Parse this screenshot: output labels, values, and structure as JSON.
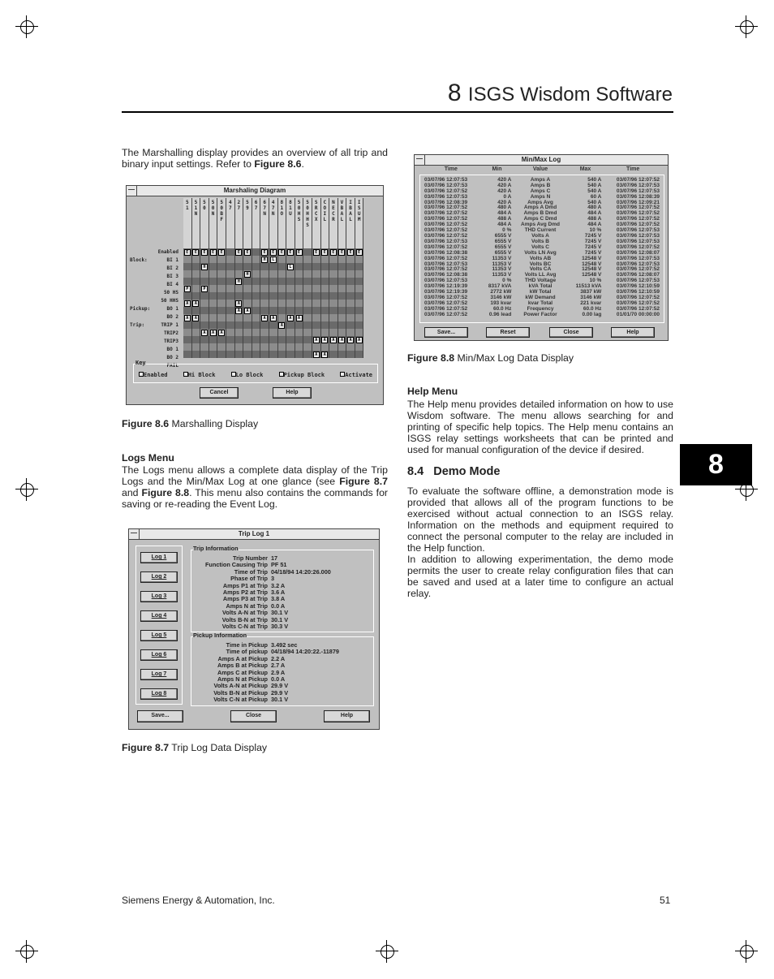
{
  "header": {
    "chapter_number": "8",
    "chapter_title": "ISGS Wisdom Software"
  },
  "tab": {
    "label": "8"
  },
  "left": {
    "intro": "The Marshalling display provides an overview of all trip and binary input settings. Refer to ",
    "intro_ref": "Figure 8.6",
    "logs_heading": "Logs Menu",
    "logs_text_1": "The Logs menu allows a complete data display of the Trip Logs and the Min/Max Log at one glance (see ",
    "logs_ref1": "Figure 8.7",
    "logs_and": " and ",
    "logs_ref2": "Figure 8.8",
    "logs_text_2": ". This menu also contains the commands for saving or re-reading the Event Log."
  },
  "fig86": {
    "label": "Figure 8.6",
    "caption": "Marshalling Display"
  },
  "fig87": {
    "label": "Figure 8.7",
    "caption": "Trip Log Data Display"
  },
  "fig88": {
    "label": "Figure 8.8",
    "caption": "Min/Max Log Data Display"
  },
  "right": {
    "help_heading": "Help Menu",
    "help_text": "The Help menu provides detailed information on how to use Wisdom software. The menu allows searching for and printing of specific help topics. The Help menu contains an ISGS relay settings worksheets that can be printed and used for manual configuration of the device if desired.",
    "demo_heading": "8.4   Demo Mode",
    "demo_p1": "To evaluate the software offline, a demonstration mode is provided that allows all of the program functions to be exercised without actual connection to an ISGS relay. Information on the methods and equipment required to connect the personal computer to the relay are included in the Help function.",
    "demo_p2": "In addition to allowing experimentation, the demo mode permits the user to create relay configuration files that can be saved and used at a later time to configure an actual relay."
  },
  "footer": {
    "company": "Siemens Energy & Automation, Inc.",
    "page": "51"
  },
  "marshalling": {
    "title": "Marshaling Diagram",
    "columns": [
      "5\n1",
      "5\n1\nN",
      "5\n0",
      "5\n0\nN",
      "5\n0\nB\nF",
      "4\n7",
      "2\n7",
      "5\n9",
      "6\n7",
      "6\n7\nN",
      "4\n7\nN",
      "8\n1\nO",
      "8\n1\nU",
      "5\n0\nH\nS",
      "5\n0\nH\nH\nS",
      "S\nR\nC\nX",
      "C\nO\nI\nL",
      "N\nE\nC\nR",
      "V\nB\nA\nL",
      "I\nB\nA\nL",
      "I\nS\nU\nM"
    ],
    "rows": [
      {
        "group": "",
        "label": "Enabled",
        "marks": "EEEEE-EE-EEEEE-EEEEEE"
      },
      {
        "group": "Block:",
        "label": "BI 1",
        "marks": "---------HL----------"
      },
      {
        "group": "",
        "label": "BI 2",
        "marks": "--H---------L--------"
      },
      {
        "group": "",
        "label": "BI 3",
        "marks": "-------H-------------"
      },
      {
        "group": "",
        "label": "BI 4",
        "marks": "------H--------------"
      },
      {
        "group": "",
        "label": "50 HS",
        "marks": "P-P------------------"
      },
      {
        "group": "",
        "label": "50 HHS",
        "marks": "---------------------"
      },
      {
        "group": "Pickup:",
        "label": "BO 1",
        "marks": "AA----A--------------"
      },
      {
        "group": "",
        "label": "BO 2",
        "marks": "------AA-------------"
      },
      {
        "group": "Trip:",
        "label": "TRIP 1",
        "marks": "AA-------AA-AA-------"
      },
      {
        "group": "",
        "label": "TRIP2",
        "marks": "-----------A---------"
      },
      {
        "group": "",
        "label": "TRIP3",
        "marks": "--AAA----------------"
      },
      {
        "group": "",
        "label": "BO 1",
        "marks": "---------------AAAAAA"
      },
      {
        "group": "",
        "label": "BO 2",
        "marks": "---------------------"
      },
      {
        "group": "",
        "label": "FAIL",
        "marks": "---------------AA----"
      }
    ],
    "key_label": "Key",
    "key": [
      "Enabled",
      "Hi Block",
      "Lo Block",
      "Pickup Block",
      "Activate"
    ],
    "cancel": "Cancel",
    "help": "Help"
  },
  "minmax": {
    "title": "Min/Max Log",
    "headers": [
      "Time",
      "Min",
      "Value",
      "Max",
      "Time"
    ],
    "rows": [
      [
        "03/07/96 12:07:53",
        "420 A",
        "Amps A",
        "540 A",
        "03/07/96 12:07:52"
      ],
      [
        "03/07/96 12:07:53",
        "420 A",
        "Amps B",
        "540 A",
        "03/07/96 12:07:53"
      ],
      [
        "03/07/96 12:07:52",
        "420 A",
        "Amps C",
        "540 A",
        "03/07/96 12:07:53"
      ],
      [
        "03/07/96 12:07:53",
        "0 A",
        "Amps N",
        "60 A",
        "03/07/96 12:08:39"
      ],
      [
        "03/07/96 12:08:39",
        "420 A",
        "Amps Avg",
        "540 A",
        "03/07/96 12:09:21"
      ],
      [
        "03/07/96 12:07:52",
        "480 A",
        "Amps A Dmd",
        "480 A",
        "03/07/96 12:07:52"
      ],
      [
        "03/07/96 12:07:52",
        "484 A",
        "Amps B Dmd",
        "484 A",
        "03/07/96 12:07:52"
      ],
      [
        "03/07/96 12:07:52",
        "488 A",
        "Amps C Dmd",
        "488 A",
        "03/07/96 12:07:52"
      ],
      [
        "03/07/96 12:07:52",
        "484 A",
        "Amps Avg Dmd",
        "484 A",
        "03/07/96 12:07:52"
      ],
      [
        "03/07/96 12:07:52",
        "0 %",
        "THD Current",
        "10 %",
        "03/07/96 12:07:53"
      ],
      [
        "03/07/96 12:07:52",
        "6555 V",
        "Volts A",
        "7245 V",
        "03/07/96 12:07:53"
      ],
      [
        "03/07/96 12:07:53",
        "6555 V",
        "Volts B",
        "7245 V",
        "03/07/96 12:07:53"
      ],
      [
        "03/07/96 12:07:52",
        "6555 V",
        "Volts C",
        "7245 V",
        "03/07/96 12:07:52"
      ],
      [
        "03/07/96 12:08:38",
        "6555 V",
        "Volts LN Avg",
        "7245 V",
        "03/07/96 12:08:07"
      ],
      [
        "03/07/96 12:07:52",
        "11353 V",
        "Volts AB",
        "12548 V",
        "03/07/96 12:07:53"
      ],
      [
        "03/07/96 12:07:53",
        "11353 V",
        "Volts BC",
        "12548 V",
        "03/07/96 12:07:53"
      ],
      [
        "03/07/96 12:07:52",
        "11353 V",
        "Volts CA",
        "12548 V",
        "03/07/96 12:07:52"
      ],
      [
        "03/07/96 12:08:38",
        "11353 V",
        "Volts LL Avg",
        "12548 V",
        "03/07/96 12:08:07"
      ],
      [
        "03/07/96 12:07:53",
        "0 %",
        "THD Voltage",
        "10 %",
        "03/07/96 12:07:53"
      ],
      [
        "03/07/96 12:19:39",
        "8317 kVA",
        "kVA Total",
        "11513 kVA",
        "03/07/96 12:10:59"
      ],
      [
        "03/07/96 12:19:39",
        "2772 kW",
        "kW Total",
        "3837 kW",
        "03/07/96 12:10:59"
      ],
      [
        "03/07/96 12:07:52",
        "3146 kW",
        "kW Demand",
        "3146 kW",
        "03/07/96 12:07:52"
      ],
      [
        "03/07/96 12:07:52",
        "193 kvar",
        "kvar Total",
        "221 kvar",
        "03/07/96 12:07:52"
      ],
      [
        "03/07/96 12:07:52",
        "60.0 Hz",
        "Frequency",
        "60.0 Hz",
        "03/07/96 12:07:52"
      ],
      [
        "03/07/96 12:07:52",
        "0.96 lead",
        "Power Factor",
        "0.00 lag",
        "01/01/70 00:00:00"
      ]
    ],
    "buttons": [
      "Save...",
      "Reset",
      "Close",
      "Help"
    ]
  },
  "triplog": {
    "title": "Trip Log 1",
    "logs": [
      "Log 1",
      "Log 2",
      "Log 3",
      "Log 4",
      "Log 5",
      "Log 6",
      "Log 7",
      "Log 8"
    ],
    "trip_group": "Trip Information",
    "trip": [
      [
        "Trip Number",
        "17"
      ],
      [
        "Function Causing Trip",
        "PF 51"
      ],
      [
        "Time of Trip",
        "04/18/94 14:20:26.000"
      ],
      [
        "Phase of Trip",
        "3"
      ],
      [
        "Amps P1 at Trip",
        "3.2 A"
      ],
      [
        "Amps P2 at Trip",
        "3.6 A"
      ],
      [
        "Amps P3 at Trip",
        "3.8 A"
      ],
      [
        "Amps N at Trip",
        "0.0 A"
      ],
      [
        "Volts A-N at Trip",
        "30.1 V"
      ],
      [
        "Volts B-N at Trip",
        "30.1 V"
      ],
      [
        "Volts C-N at Trip",
        "30.3 V"
      ]
    ],
    "pickup_group": "Pickup Information",
    "pickup": [
      [
        "Time in Pickup",
        "3.492 sec"
      ],
      [
        "Time of pickup",
        "04/18/94 14:20:22.-11879"
      ],
      [
        "Amps A at Pickup",
        "2.2 A"
      ],
      [
        "Amps B at Pickup",
        "2.7 A"
      ],
      [
        "Amps C at Pickup",
        "2.9 A"
      ],
      [
        "Amps N at Pickup",
        "0.0 A"
      ],
      [
        "Volts A-N at Pickup",
        "29.9 V"
      ],
      [
        "Volts B-N at Pickup",
        "29.9 V"
      ],
      [
        "Volts C-N at Pickup",
        "30.1 V"
      ]
    ],
    "buttons": [
      "Save...",
      "Close",
      "Help"
    ]
  }
}
